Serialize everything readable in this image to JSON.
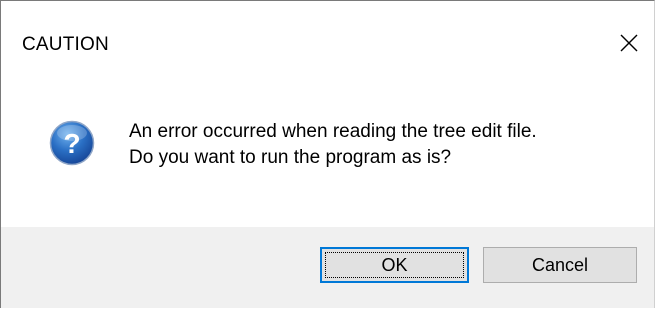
{
  "dialog": {
    "title": "CAUTION",
    "close_icon": "close-icon",
    "icon": "question-icon",
    "accent_color": "#0078d7",
    "message_lines": [
      "An error occurred when reading the tree edit file.",
      "Do you want to run the program as is?"
    ],
    "buttons": {
      "ok_label": "OK",
      "cancel_label": "Cancel"
    }
  }
}
